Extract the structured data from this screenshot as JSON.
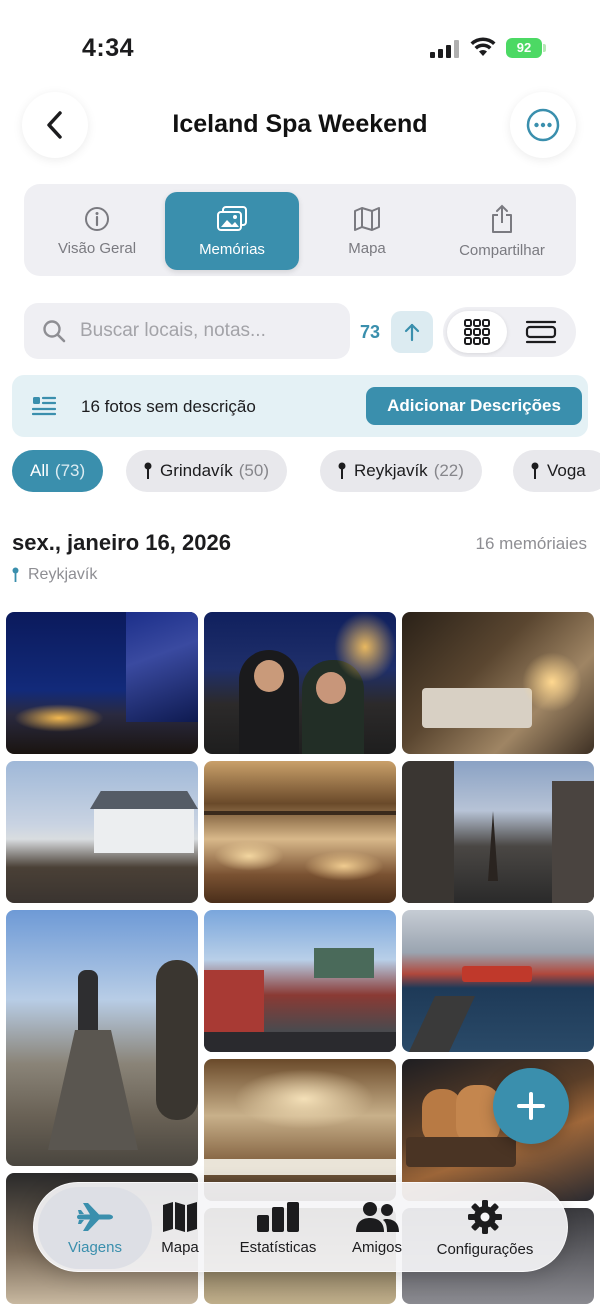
{
  "status_bar": {
    "time": "4:34",
    "battery": "92"
  },
  "header": {
    "title": "Iceland Spa Weekend"
  },
  "tabs": [
    {
      "label": "Visão Geral",
      "icon": "info-icon"
    },
    {
      "label": "Memórias",
      "icon": "photos-icon",
      "active": true
    },
    {
      "label": "Mapa",
      "icon": "map-icon"
    },
    {
      "label": "Compartilhar",
      "icon": "share-icon"
    }
  ],
  "search": {
    "placeholder": "Buscar locais, notas...",
    "count": "73"
  },
  "banner": {
    "text": "16 fotos sem descrição",
    "button": "Adicionar Descrições"
  },
  "filters": [
    {
      "label": "All",
      "count": "(73)",
      "active": true
    },
    {
      "label": "Grindavík",
      "count": "(50)"
    },
    {
      "label": "Reykjavík",
      "count": "(22)"
    },
    {
      "label": "Voga",
      "count": ""
    }
  ],
  "section": {
    "date": "sex., janeiro 16, 2026",
    "count": "16 memóriaies",
    "location": "Reykjavík"
  },
  "nav": [
    {
      "label": "Viagens",
      "icon": "airplane-icon",
      "active": true
    },
    {
      "label": "Mapa",
      "icon": "map-icon"
    },
    {
      "label": "Estatísticas",
      "icon": "bar-chart-icon"
    },
    {
      "label": "Amigos",
      "icon": "people-icon"
    },
    {
      "label": "Configurações",
      "icon": "gear-icon"
    }
  ],
  "colors": {
    "accent": "#3a8fad"
  }
}
